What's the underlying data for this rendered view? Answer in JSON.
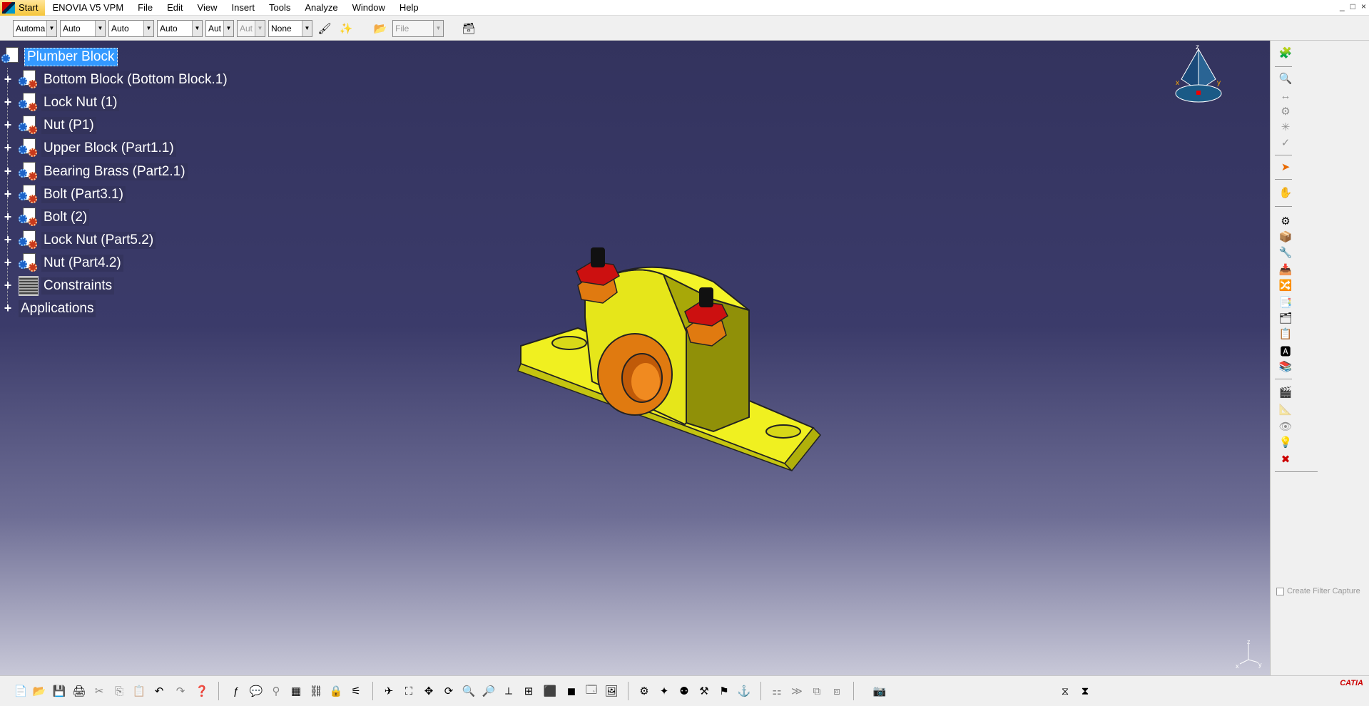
{
  "menubar": {
    "items": [
      "Start",
      "ENOVIA V5 VPM",
      "File",
      "Edit",
      "View",
      "Insert",
      "Tools",
      "Analyze",
      "Window",
      "Help"
    ]
  },
  "window_controls": [
    "_",
    "□",
    "×"
  ],
  "toolbar": {
    "combos": [
      {
        "value": "Automa",
        "disabled": false
      },
      {
        "value": "Auto",
        "disabled": false
      },
      {
        "value": "Auto",
        "disabled": false
      },
      {
        "value": "Auto",
        "disabled": false
      },
      {
        "value": "Aut",
        "disabled": false
      },
      {
        "value": "Aut",
        "disabled": true
      },
      {
        "value": "None",
        "disabled": false
      }
    ],
    "file_combo": "File"
  },
  "tree": {
    "root": "Plumber Block",
    "children": [
      "Bottom Block (Bottom Block.1)",
      "Lock Nut (1)",
      "Nut (P1)",
      "Upper Block (Part1.1)",
      "Bearing Brass (Part2.1)",
      "Bolt (Part3.1)",
      "Bolt (2)",
      "Lock Nut (Part5.2)",
      "Nut (Part4.2)",
      "Constraints"
    ],
    "applications": "Applications"
  },
  "compass": {
    "z": "z",
    "x": "x",
    "y": "y"
  },
  "axes": {
    "z": "z",
    "x": "x",
    "y": "y"
  },
  "right_panel": {
    "filter_capture": "Create Filter Capture"
  },
  "logo": "CATIA",
  "colors": {
    "viewport_top": "#33335e",
    "viewport_bottom": "#c8c8d8",
    "part": "#e6e61a",
    "brass": "#e07a10",
    "nut": "#cc1010"
  }
}
